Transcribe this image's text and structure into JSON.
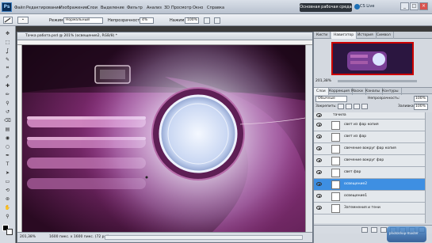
{
  "app": {
    "logo": "Ps"
  },
  "menu": [
    "Файл",
    "Редактирование",
    "Изображение",
    "Слои",
    "Выделение",
    "Фильтр",
    "Анализ",
    "3D",
    "Просмотр",
    "Окно",
    "Справка"
  ],
  "zoom_display": "201%",
  "workspace_button": "Основная рабочая среда",
  "cs_live": "CS Live",
  "window_controls": [
    "_",
    "□",
    "×"
  ],
  "options": {
    "mode_label": "Режим:",
    "mode_value": "Нормальный",
    "opacity_label": "Непрозрачность:",
    "opacity_value": "4%",
    "pressure_label": "Нажим:",
    "pressure_value": "100%"
  },
  "document": {
    "title": "Тачка работа.psd @ 201% (освещение2, RGB/8) *",
    "zoom": "201,38%",
    "docinfo": "1600 пикс. x 1600 пикс. (72 ppi)"
  },
  "navigator": {
    "tabs": [
      "Кисти",
      "Навигатор",
      "История",
      "Символ"
    ],
    "zoom": "201,38%"
  },
  "layers_panel": {
    "tabs": [
      "Слои",
      "Коррекция",
      "Маски",
      "Каналы",
      "Контуры"
    ],
    "blend_mode": "Обычные",
    "opacity_label": "Непрозрачность:",
    "opacity_value": "100%",
    "lock_label": "Закрепить:",
    "fill_label": "Заливка:",
    "fill_value": "100%",
    "group_name": "тачила",
    "layers": [
      {
        "name": "свет из фар копия",
        "selected": false
      },
      {
        "name": "свет из фар",
        "selected": false
      },
      {
        "name": "свечение вокруг фар копия",
        "selected": false
      },
      {
        "name": "свечение вокруг фар",
        "selected": false
      },
      {
        "name": "свет фар",
        "selected": false
      },
      {
        "name": "освещение2",
        "selected": true
      },
      {
        "name": "освещение1",
        "selected": false
      },
      {
        "name": "Затемнения и тени",
        "selected": false
      }
    ]
  },
  "tools": [
    "move-icon",
    "marquee-icon",
    "lasso-icon",
    "quick-select-icon",
    "crop-icon",
    "eyedropper-icon",
    "healing-icon",
    "brush-icon",
    "stamp-icon",
    "history-brush-icon",
    "eraser-icon",
    "gradient-icon",
    "blur-icon",
    "dodge-icon",
    "pen-icon",
    "type-icon",
    "path-select-icon",
    "shape-icon",
    "3d-rotate-icon",
    "3d-orbit-icon",
    "hand-icon",
    "zoom-icon"
  ],
  "watermark": "photoshop-master"
}
